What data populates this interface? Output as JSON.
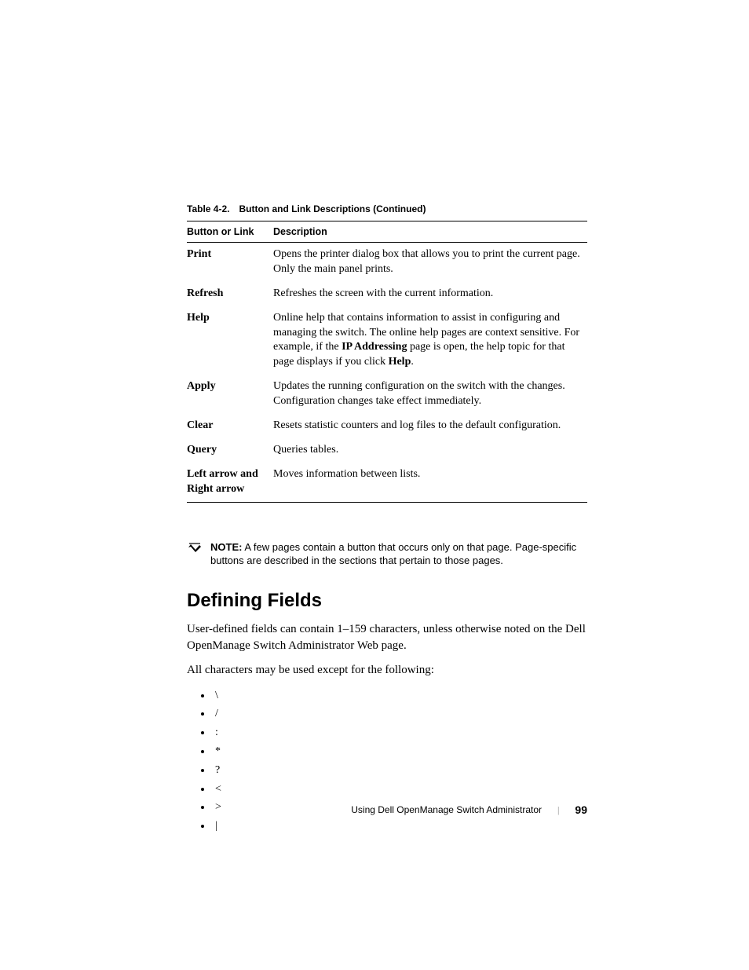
{
  "table": {
    "caption_num": "Table 4-2.",
    "caption_title": "Button and Link Descriptions (Continued)",
    "headers": {
      "col1": "Button or Link",
      "col2": "Description"
    },
    "rows": [
      {
        "label": "Print",
        "desc": "Opens the printer dialog box that allows you to print the current page. Only the main panel prints."
      },
      {
        "label": "Refresh",
        "desc": "Refreshes the screen with the current information."
      },
      {
        "label": "Help",
        "desc_pre": "Online help that contains information to assist in configuring and managing the switch. The online help pages are context sensitive. For example, if the ",
        "desc_bold1": "IP Addressing",
        "desc_mid": " page is open, the help topic for that page displays if you click ",
        "desc_bold2": "Help",
        "desc_post": "."
      },
      {
        "label": "Apply",
        "desc": "Updates the running configuration on the switch with the changes. Configuration changes take effect immediately."
      },
      {
        "label": "Clear",
        "desc": "Resets statistic counters and log files to the default configuration."
      },
      {
        "label": "Query",
        "desc": "Queries tables."
      },
      {
        "label": "Left arrow and Right arrow",
        "desc": "Moves information between lists."
      }
    ]
  },
  "note": {
    "label": "NOTE:",
    "text": " A few pages contain a button that occurs only on that page. Page-specific buttons are described in the sections that pertain to those pages."
  },
  "section": {
    "heading": "Defining Fields",
    "para1": "User-defined fields can contain 1–159 characters, unless otherwise noted on the Dell OpenManage Switch Administrator Web page.",
    "para2": "All characters may be used except for the following:",
    "chars": [
      "\\",
      "/",
      ":",
      "*",
      "?",
      "<",
      ">",
      "|"
    ]
  },
  "footer": {
    "title": "Using Dell OpenManage Switch Administrator",
    "page": "99"
  }
}
